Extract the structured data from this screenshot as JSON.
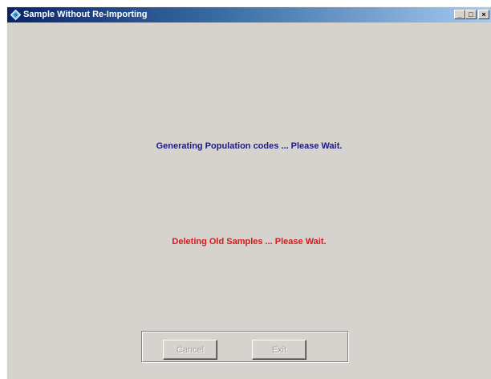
{
  "window": {
    "title": "Sample Without Re-Importing",
    "icon": "diamond-app-icon",
    "controls": {
      "minimize": "_",
      "maximize": "□",
      "close": "×"
    }
  },
  "messages": {
    "status_primary": "Generating Population codes ... Please Wait.",
    "status_secondary": "Deleting Old Samples ... Please Wait."
  },
  "buttons": {
    "cancel_label": "Cancel",
    "exit_label": "Exit"
  },
  "colors": {
    "status_primary": "#1a1a8c",
    "status_secondary": "#d41a1a",
    "window_bg": "#d6d3ce",
    "titlebar_start": "#0a246a",
    "titlebar_end": "#a6caf0"
  }
}
